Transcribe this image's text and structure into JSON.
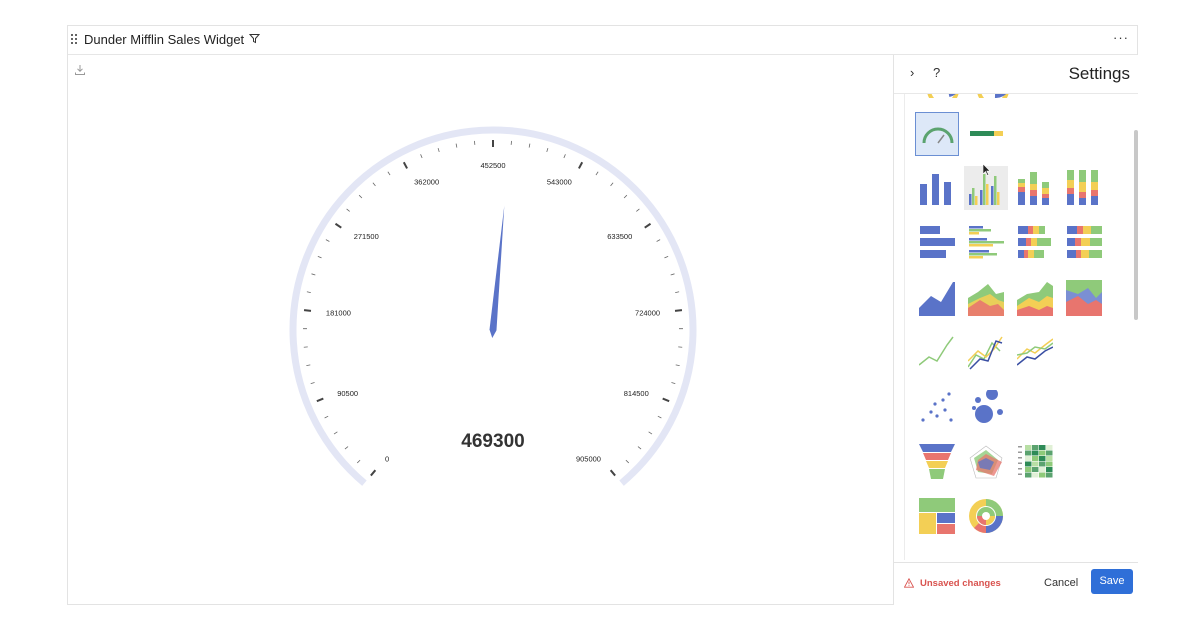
{
  "widget": {
    "title": "Dunder Mifflin Sales Widget",
    "more_icon": "more-horizontal-icon",
    "filter_icon": "filter-icon",
    "download_icon": "download-icon"
  },
  "gauge": {
    "value": 469300,
    "display_value": "469300",
    "min": 0,
    "max": 905000,
    "tick_labels": [
      "0",
      "90500",
      "181000",
      "271500",
      "362000",
      "452500",
      "543000",
      "633500",
      "724000",
      "814500",
      "905000"
    ],
    "colors": {
      "arc": "#e3e6f5",
      "needle": "#5a73c8",
      "value_text": "#333333"
    }
  },
  "settings": {
    "title": "Settings",
    "collapse_icon": "chevron-right-icon",
    "help_label": "?",
    "unsaved_label": "Unsaved changes",
    "cancel_label": "Cancel",
    "save_label": "Save",
    "selected_chart_type": "gauge",
    "chart_types": [
      "gauge",
      "progress-bar",
      "column",
      "column-grouped",
      "column-stacked",
      "column-stacked-100",
      "bar",
      "bar-grouped",
      "bar-stacked",
      "bar-stacked-100",
      "area",
      "area-overlap",
      "area-stacked",
      "area-stacked-100",
      "line",
      "line-multi",
      "line-multi-smooth",
      "scatter",
      "bubble",
      "funnel",
      "radar",
      "heatmap",
      "treemap",
      "sunburst"
    ],
    "colors": {
      "blue": "#5a73c8",
      "green": "#8fca7a",
      "yellow": "#f3cf55",
      "red": "#e8756e",
      "accent": "#2f6fd8",
      "warning": "#d9534f"
    }
  }
}
